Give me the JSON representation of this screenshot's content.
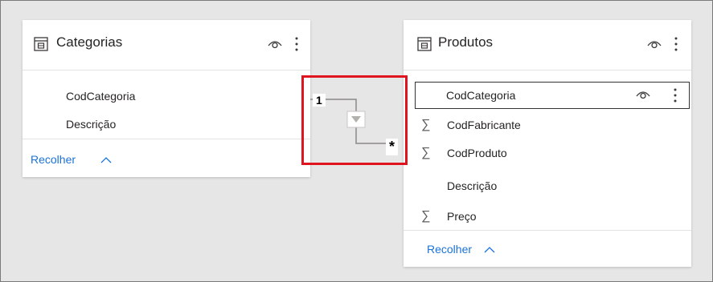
{
  "tables": {
    "categorias": {
      "title": "Categorias",
      "fields": [
        {
          "name": "CodCategoria",
          "aggregate": false
        },
        {
          "name": "Descrição",
          "aggregate": false
        }
      ],
      "collapse_label": "Recolher"
    },
    "produtos": {
      "title": "Produtos",
      "fields": [
        {
          "name": "CodCategoria",
          "aggregate": false,
          "selected": true
        },
        {
          "name": "CodFabricante",
          "aggregate": true
        },
        {
          "name": "CodProduto",
          "aggregate": true
        },
        {
          "name": "Descrição",
          "aggregate": false
        },
        {
          "name": "Preço",
          "aggregate": true
        }
      ],
      "collapse_label": "Recolher"
    }
  },
  "relationship": {
    "one_side_label": "1",
    "many_side_label": "*",
    "filter_direction": "single"
  },
  "icons": {
    "table": "table-icon",
    "visibility": "eye-icon",
    "more": "more-options-icon",
    "aggregate": "sigma-icon",
    "collapse": "chevron-up-icon",
    "filter_direction": "filter-arrow-icon"
  },
  "colors": {
    "canvas": "#e6e6e6",
    "card": "#ffffff",
    "link": "#1a73d9",
    "highlight": "#e0141e",
    "text": "#252423"
  }
}
